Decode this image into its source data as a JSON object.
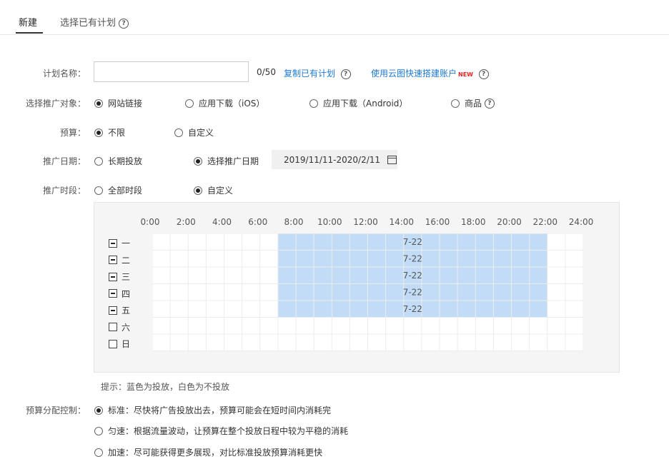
{
  "tabs": {
    "new": "新建",
    "select_existing": "选择已有计划"
  },
  "plan_name": {
    "label": "计划名称：",
    "value": "",
    "counter": "0/50",
    "copy_link": "复制已有计划",
    "cloud_link": "使用云图快速搭建账户",
    "new_badge": "NEW"
  },
  "target": {
    "label": "选择推广对象：",
    "options": [
      "网站链接",
      "应用下载（iOS）",
      "应用下载（Android）",
      "商品"
    ],
    "selected": 0
  },
  "budget": {
    "label": "预算：",
    "options": [
      "不限",
      "自定义"
    ],
    "selected": 0
  },
  "date": {
    "label": "推广日期：",
    "options": [
      "长期投放",
      "选择推广日期"
    ],
    "selected": 1,
    "range": "2019/11/11-2020/2/11"
  },
  "time": {
    "label": "推广时段：",
    "options": [
      "全部时段",
      "自定义"
    ],
    "selected": 1
  },
  "schedule": {
    "hours": [
      "0:00",
      "2:00",
      "4:00",
      "6:00",
      "8:00",
      "10:00",
      "12:00",
      "14:00",
      "16:00",
      "18:00",
      "20:00",
      "22:00",
      "24:00"
    ],
    "days": [
      {
        "name": "一",
        "state": "partial",
        "range": "7-22",
        "start": 7,
        "end": 22
      },
      {
        "name": "二",
        "state": "partial",
        "range": "7-22",
        "start": 7,
        "end": 22
      },
      {
        "name": "三",
        "state": "partial",
        "range": "7-22",
        "start": 7,
        "end": 22
      },
      {
        "name": "四",
        "state": "partial",
        "range": "7-22",
        "start": 7,
        "end": 22
      },
      {
        "name": "五",
        "state": "partial",
        "range": "7-22",
        "start": 7,
        "end": 22
      },
      {
        "name": "六",
        "state": "none",
        "range": ""
      },
      {
        "name": "日",
        "state": "none",
        "range": ""
      }
    ],
    "selected_color": "#c2dcf7",
    "hint": "提示：蓝色为投放，白色为不投放"
  },
  "budget_control": {
    "label": "预算分配控制：",
    "options": [
      "标准：尽快将广告投放出去，预算可能会在短时间内消耗完",
      "匀速：根据流量波动，让预算在整个投放日程中较为平稳的消耗",
      "加速：尽可能获得更多展现，对比标准投放预算消耗更快"
    ],
    "selected": 0
  }
}
